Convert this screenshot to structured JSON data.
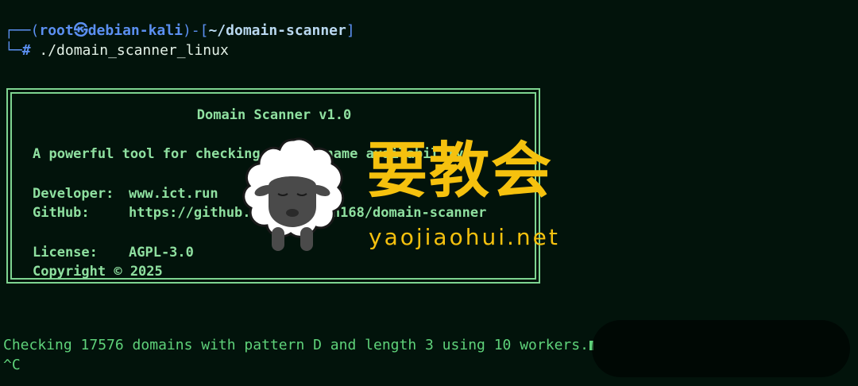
{
  "prompt": {
    "corner_top": "┌──",
    "open_paren": "(",
    "user": "root",
    "at_symbol": "㉿",
    "host": "debian-kali",
    "close_paren": ")",
    "dash": "-",
    "open_bracket": "[",
    "path": "~/domain-scanner",
    "close_bracket": "]",
    "corner_bottom": "└─",
    "hash": "#",
    "command": "./domain_scanner_linux"
  },
  "banner": {
    "title": "Domain Scanner v1.0",
    "description": "A powerful tool for checking domain name availability",
    "developer_label": "Developer:",
    "developer_value": "www.ict.run",
    "github_label": "GitHub:",
    "github_value": "https://github.com/xuemian168/domain-scanner",
    "license_label": "License:",
    "license_value": "AGPL-3.0",
    "copyright": "Copyright © 2025"
  },
  "output": {
    "status_line": "Checking 17576 domains with pattern D and length 3 using 10 workers.",
    "interrupt": "^C"
  },
  "watermark": {
    "chinese": "要教会",
    "url": "yaojiaohui.net",
    "mascot_icon": "sheep-icon"
  },
  "colors": {
    "background": "#02130b",
    "banner_green": "#8fe0a0",
    "status_green": "#5fd27a",
    "prompt_blue": "#5b8ff0",
    "watermark_yellow": "#f5c10e"
  }
}
